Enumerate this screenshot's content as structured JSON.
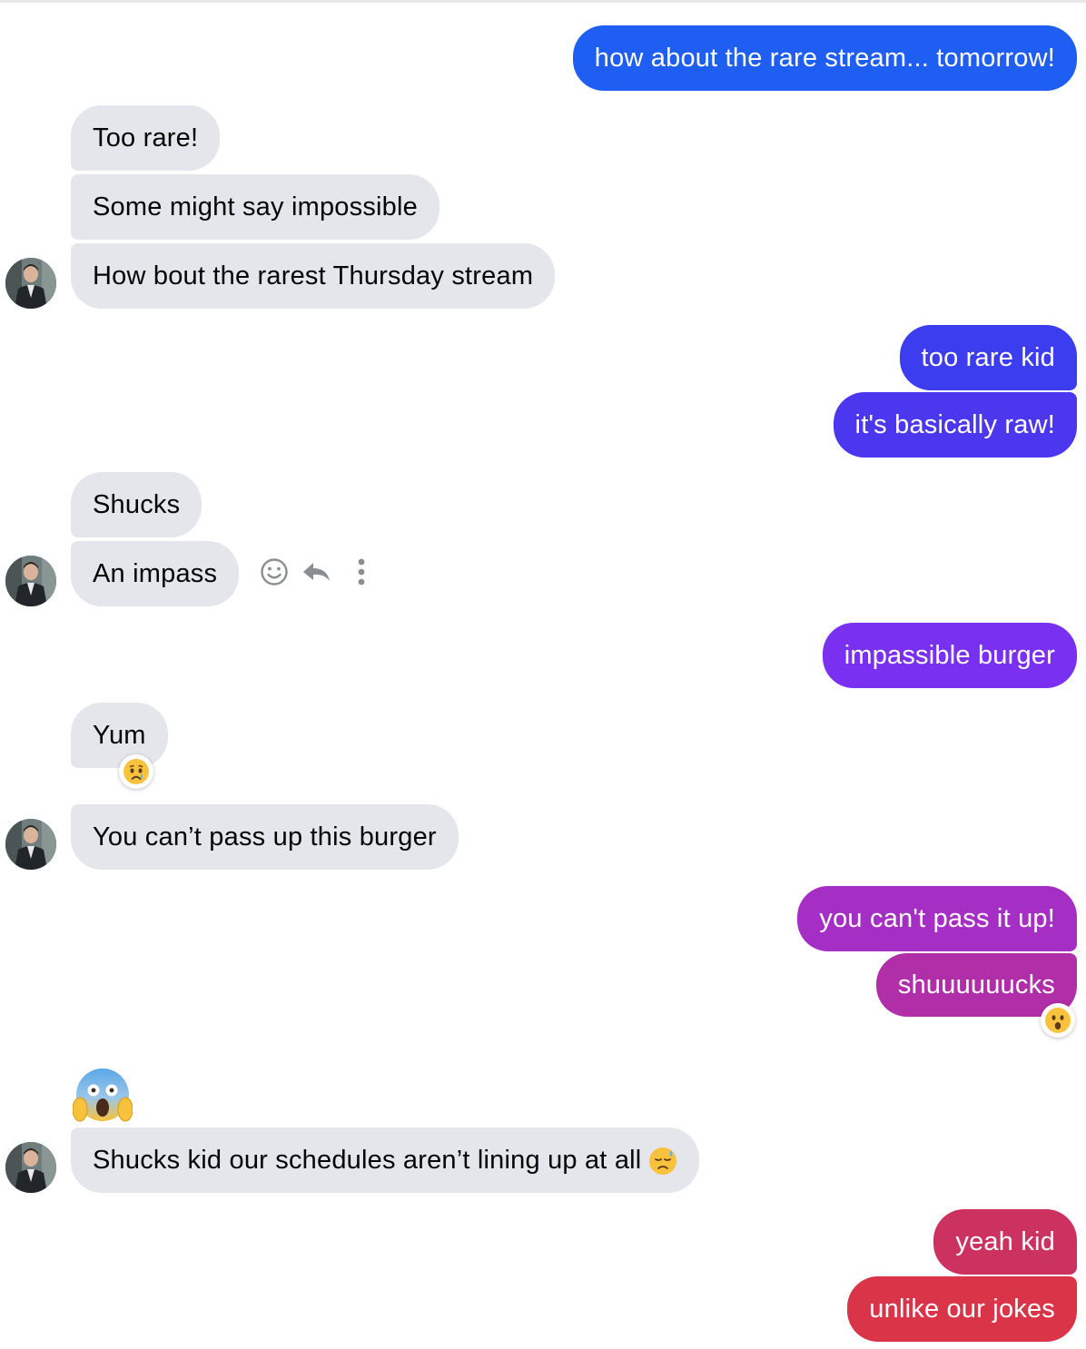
{
  "messages": {
    "m1": "how about the rare stream... tomorrow!",
    "m2": "Too rare!",
    "m3": "Some might say impossible",
    "m4": "How bout the rarest Thursday stream",
    "m5": "too rare kid",
    "m6": "it's basically raw!",
    "m7": "Shucks",
    "m8": "An impass",
    "m9": "impassible burger",
    "m10": "Yum",
    "m11": "You can’t pass up this burger",
    "m12": "you can't pass it up!",
    "m13": "shuuuuuucks",
    "m14": "Shucks kid our schedules aren’t lining up at all",
    "m15": "yeah kid",
    "m16": "unlike our jokes"
  },
  "colors": {
    "incoming_bg": "#e4e6eb",
    "out_m1": "#1f5ef2",
    "out_m5": "#3d3df0",
    "out_m6": "#4a37ee",
    "out_m9": "#7a30f0",
    "out_m12": "#a52fc4",
    "out_m13": "#b02ea8",
    "out_m15": "#cc3260",
    "out_m16": "#d93448"
  },
  "icons": {
    "reaction_yum": "crying-face",
    "reaction_shucks": "surprised-face",
    "big_emoji": "screaming-face",
    "inline_emoji": "downcast-sweat-face",
    "hover_actions": [
      "smiley-icon",
      "reply-icon",
      "more-icon"
    ]
  }
}
